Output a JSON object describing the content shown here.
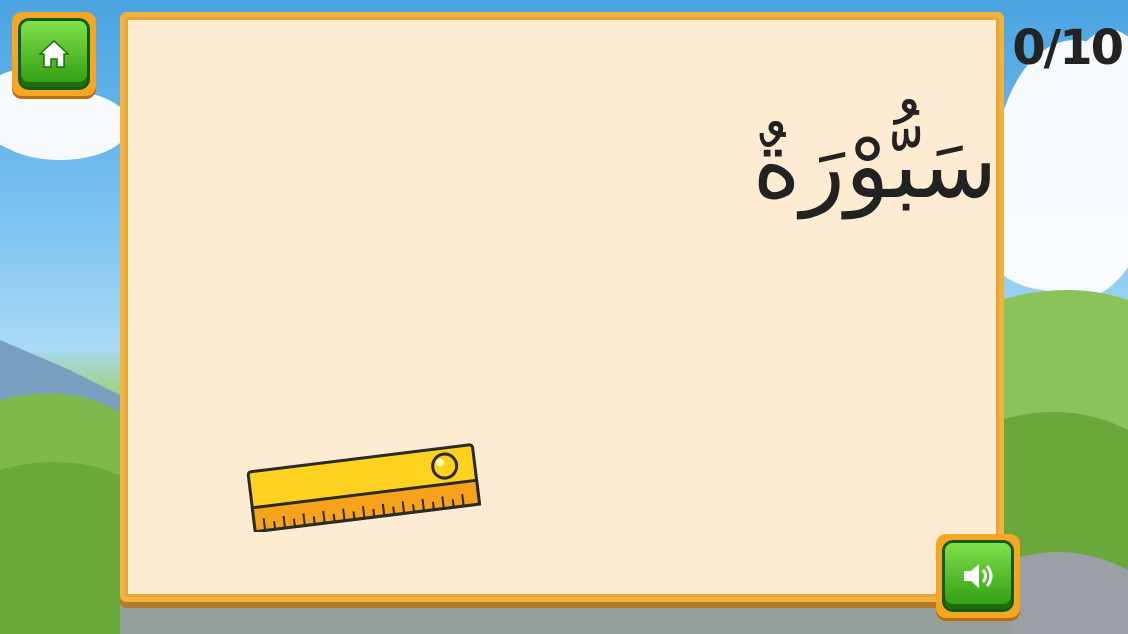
{
  "score": {
    "text": "0/10"
  },
  "card": {
    "word": "سَبُّوْرَةٌ"
  },
  "buttons": {
    "home": "home-icon",
    "sound": "speaker-icon"
  },
  "colors": {
    "accent": "#f5a623",
    "button_green": "#3bb11a",
    "card": "#fdebd2"
  }
}
